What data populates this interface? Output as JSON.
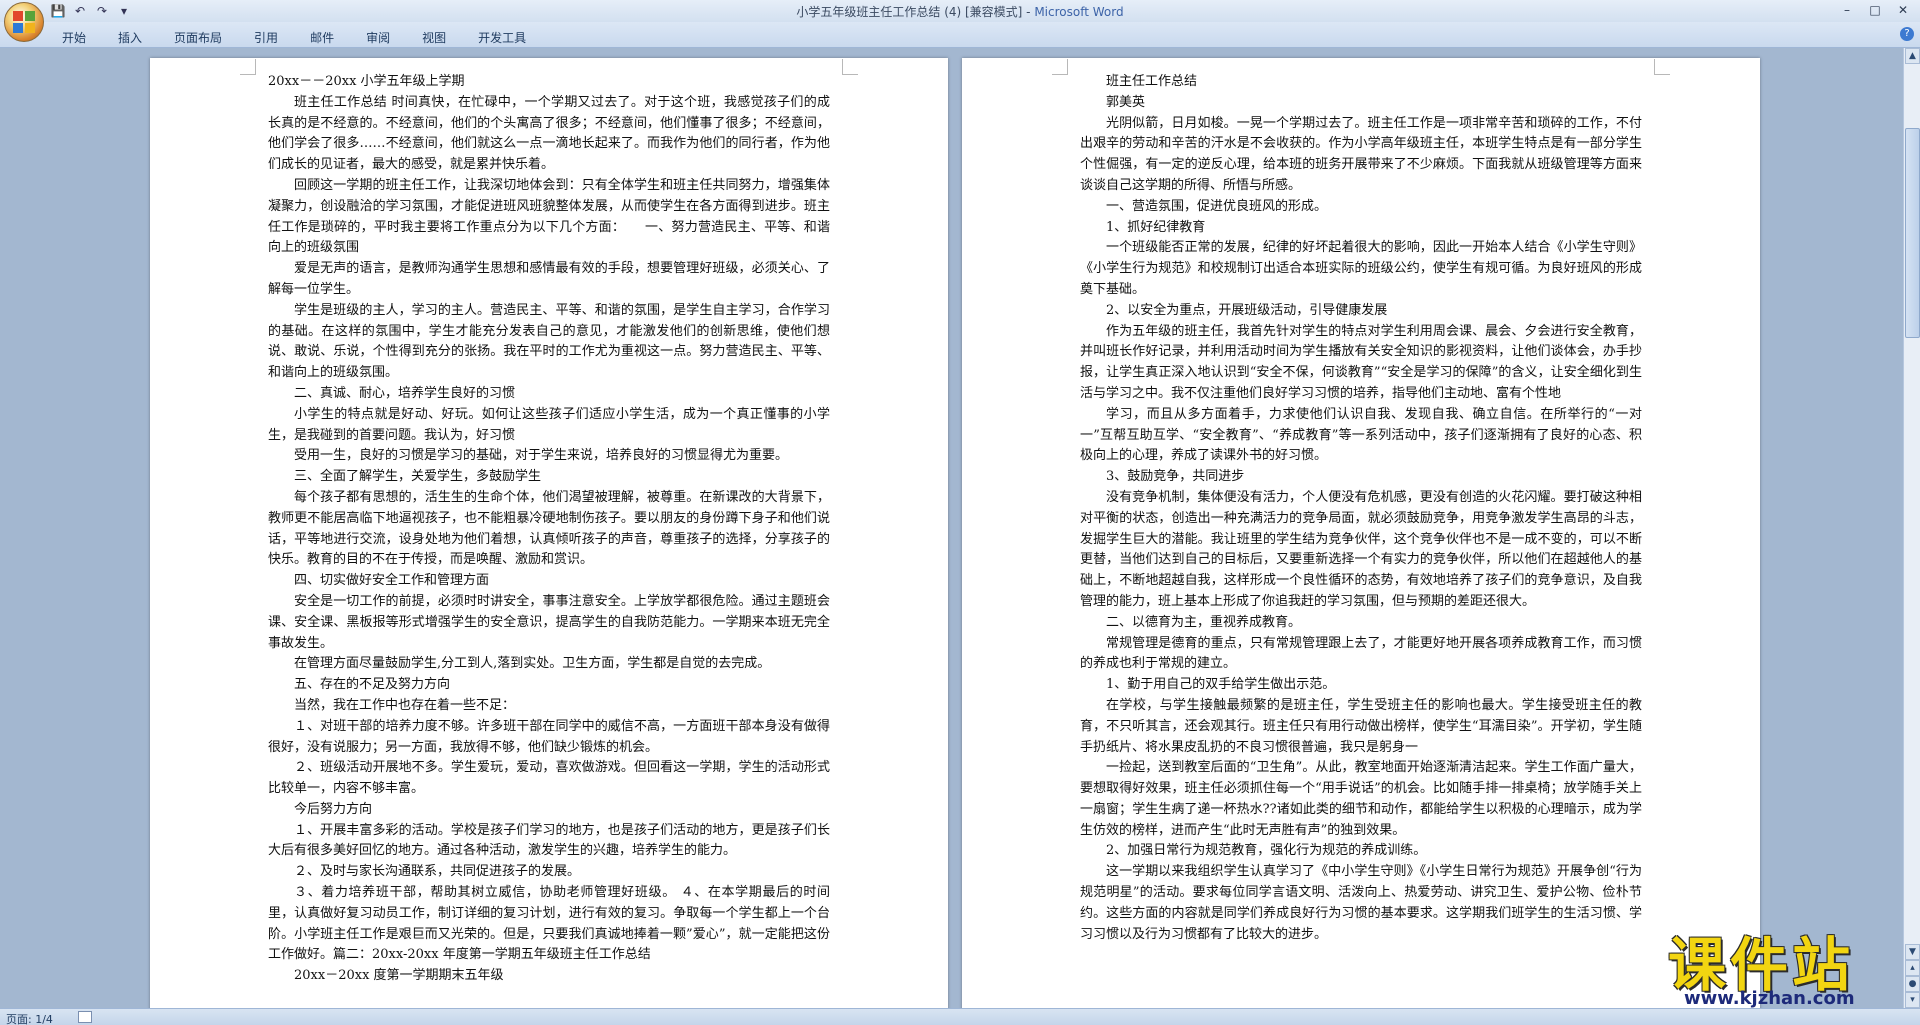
{
  "window": {
    "title": "小学五年级班主任工作总结 (4) [兼容模式] - ",
    "app_name": "Microsoft Word"
  },
  "quick_access": [
    "save-icon",
    "undo-icon",
    "redo-icon",
    "customize-icon"
  ],
  "ribbon": {
    "tabs": [
      "开始",
      "插入",
      "页面布局",
      "引用",
      "邮件",
      "审阅",
      "视图",
      "开发工具"
    ],
    "help_label": "?"
  },
  "window_controls": [
    "–",
    "□",
    "✕"
  ],
  "left_page": {
    "paragraphs": [
      {
        "t": "20xx－－20xx 小学五年级上学期",
        "i": 0
      },
      {
        "t": "班主任工作总结 时间真快，在忙碌中，一个学期又过去了。对于这个班，我感觉孩子们的成长真的是不经意的。不经意间，他们的个头寓高了很多；不经意间，他们懂事了很多；不经意间，他们学会了很多……不经意间，他们就这么一点一滴地长起来了。而我作为他们的同行者，作为他们成长的见证者，最大的感受，就是累并快乐着。",
        "i": 1
      },
      {
        "t": "回顾这一学期的班主任工作，让我深切地体会到：只有全体学生和班主任共同努力，增强集体凝聚力，创设融洽的学习氛围，才能促进班风班貌整体发展，从而使学生在各方面得到进步。班主任工作是琐碎的，平时我主要将工作重点分为以下几个方面：　　一、努力营造民主、平等、和谐向上的班级氛围",
        "i": 1
      },
      {
        "t": "爱是无声的语言，是教师沟通学生思想和感情最有效的手段，想要管理好班级，必须关心、了解每一位学生。",
        "i": 1
      },
      {
        "t": "学生是班级的主人，学习的主人。营造民主、平等、和谐的氛围，是学生自主学习，合作学习的基础。在这样的氛围中，学生才能充分发表自己的意见，才能激发他们的创新思维，使他们想说、敢说、乐说，个性得到充分的张扬。我在平时的工作尤为重视这一点。努力营造民主、平等、和谐向上的班级氛围。",
        "i": 1
      },
      {
        "t": "二、真诚、耐心，培养学生良好的习惯",
        "i": 1
      },
      {
        "t": "小学生的特点就是好动、好玩。如何让这些孩子们适应小学生活，成为一个真正懂事的小学生，是我碰到的首要问题。我认为，好习惯",
        "i": 1
      },
      {
        "t": "受用一生，良好的习惯是学习的基础，对于学生来说，培养良好的习惯显得尤为重要。",
        "i": 1
      },
      {
        "t": "三、全面了解学生，关爱学生，多鼓励学生",
        "i": 1
      },
      {
        "t": "每个孩子都有思想的，活生生的生命个体，他们渴望被理解，被尊重。在新课改的大背景下，教师更不能居高临下地逼视孩子，也不能粗暴冷硬地制伤孩子。要以朋友的身份蹲下身子和他们说话，平等地进行交流，设身处地为他们着想，认真倾听孩子的声音，尊重孩子的选择，分享孩子的快乐。教育的目的不在于传授，而是唤醒、激励和赏识。",
        "i": 1
      },
      {
        "t": "四、切实做好安全工作和管理方面",
        "i": 1
      },
      {
        "t": "安全是一切工作的前提，必须时时讲安全，事事注意安全。上学放学都很危险。通过主题班会课、安全课、黑板报等形式增强学生的安全意识，提高学生的自我防范能力。一学期来本班无完全事故发生。",
        "i": 1
      },
      {
        "t": "在管理方面尽量鼓励学生,分工到人,落到实处。卫生方面，学生都是自觉的去完成。",
        "i": 1
      },
      {
        "t": "五、存在的不足及努力方向",
        "i": 1
      },
      {
        "t": "当然，我在工作中也存在着一些不足：",
        "i": 1
      },
      {
        "t": "１、对班干部的培养力度不够。许多班干部在同学中的威信不高，一方面班干部本身没有做得很好，没有说服力；另一方面，我放得不够，他们缺少锻炼的机会。",
        "i": 1
      },
      {
        "t": "２、班级活动开展地不多。学生爱玩，爱动，喜欢做游戏。但回看这一学期，学生的活动形式比较单一，内容不够丰富。",
        "i": 1
      },
      {
        "t": "今后努力方向",
        "i": 1
      },
      {
        "t": "１、开展丰富多彩的活动。学校是孩子们学习的地方，也是孩子们活动的地方，更是孩子们长大后有很多美好回忆的地方。通过各种活动，激发学生的兴趣，培养学生的能力。",
        "i": 1
      },
      {
        "t": "２、及时与家长沟通联系，共同促进孩子的发展。",
        "i": 1
      },
      {
        "t": "３、着力培养班干部，帮助其树立威信，协助老师管理好班级。 ４、在本学期最后的时间里，认真做好复习动员工作，制订详细的复习计划，进行有效的复习。争取每一个学生都上一个台阶。小学班主任工作是艰巨而又光荣的。但是，只要我们真诚地捧着一颗”爱心”，就一定能把这份工作做好。篇二：20xx-20xx 年度第一学期五年级班主任工作总结",
        "i": 1
      },
      {
        "t": "20xx－20xx 度第一学期期末五年级",
        "i": 1
      }
    ]
  },
  "right_page": {
    "paragraphs": [
      {
        "t": "班主任工作总结",
        "i": 1
      },
      {
        "t": "郭美英",
        "i": 1
      },
      {
        "t": "光阴似箭，日月如梭。一晃一个学期过去了。班主任工作是一项非常辛苦和琐碎的工作，不付出艰辛的劳动和辛苦的汗水是不会收获的。作为小学高年级班主任，本班学生特点是有一部分学生个性倔强，有一定的逆反心理，给本班的班务开展带来了不少麻烦。下面我就从班级管理等方面来谈谈自己这学期的所得、所悟与所感。",
        "i": 1
      },
      {
        "t": "一、营造氛围，促进优良班风的形成。",
        "i": 1
      },
      {
        "t": "1、抓好纪律教育",
        "i": 1
      },
      {
        "t": "一个班级能否正常的发展，纪律的好坏起着很大的影响，因此一开始本人结合《小学生守则》《小学生行为规范》和校规制订出适合本班实际的班级公约，使学生有规可循。为良好班风的形成奠下基础。",
        "i": 1
      },
      {
        "t": "2、以安全为重点，开展班级活动，引导健康发展",
        "i": 1
      },
      {
        "t": "作为五年级的班主任，我首先针对学生的特点对学生利用周会课、晨会、夕会进行安全教育，并叫班长作好记录，并利用活动时间为学生播放有关安全知识的影视资料，让他们谈体会，办手抄报，让学生真正深入地认识到“安全不保，何谈教育”“安全是学习的保障”的含义，让安全细化到生活与学习之中。我不仅注重他们良好学习习惯的培养，指导他们主动地、富有个性地",
        "i": 1
      },
      {
        "t": "学习，而且从多方面着手，力求使他们认识自我、发现自我、确立自信。在所举行的“一对一”互帮互助互学、“安全教育”、“养成教育”等一系列活动中，孩子们逐渐拥有了良好的心态、积极向上的心理，养成了读课外书的好习惯。",
        "i": 1
      },
      {
        "t": "3、鼓励竞争，共同进步",
        "i": 1
      },
      {
        "t": "没有竞争机制，集体便没有活力，个人便没有危机感，更没有创造的火花闪耀。要打破这种相对平衡的状态，创造出一种充满活力的竞争局面，就必须鼓励竞争，用竞争激发学生高昂的斗志，发掘学生巨大的潜能。我让班里的学生结为竞争伙伴，这个竞争伙伴也不是一成不变的，可以不断更替，当他们达到自己的目标后，又要重新选择一个有实力的竞争伙伴，所以他们在超越他人的基础上，不断地超越自我，这样形成一个良性循环的态势，有效地培养了孩子们的竞争意识，及自我管理的能力，班上基本上形成了你追我赶的学习氛围，但与预期的差距还很大。",
        "i": 1
      },
      {
        "t": "二、以德育为主，重视养成教育。",
        "i": 1
      },
      {
        "t": "常规管理是德育的重点，只有常规管理跟上去了，才能更好地开展各项养成教育工作，而习惯的养成也利于常规的建立。",
        "i": 1
      },
      {
        "t": "1、勤于用自己的双手给学生做出示范。",
        "i": 1
      },
      {
        "t": "在学校，与学生接触最频繁的是班主任，学生受班主任的影响也最大。学生接受班主任的教育，不只听其言，还会观其行。班主任只有用行动做出榜样，使学生“耳濡目染”。开学初，学生随手扔纸片、将水果皮乱扔的不良习惯很普遍，我只是躬身一",
        "i": 1
      },
      {
        "t": "一捡起，送到教室后面的“卫生角”。从此，教室地面开始逐渐清洁起来。学生工作面广量大，要想取得好效果，班主任必须抓住每一个“用手说话”的机会。比如随手排一排桌椅；放学随手关上一扇窗；学生生病了递一杯热水??诸如此类的细节和动作，都能给学生以积极的心理暗示，成为学生仿效的榜样，进而产生“此时无声胜有声”的独到效果。",
        "i": 1
      },
      {
        "t": "2、加强日常行为规范教育，强化行为规范的养成训练。",
        "i": 1
      },
      {
        "t": "这一学期以来我组织学生认真学习了《中小学生守则》《小学生日常行为规范》开展争创“行为规范明星”的活动。要求每位同学言语文明、活泼向上、热爱劳动、讲究卫生、爱护公物、俭朴节约。这些方面的内容就是同学们养成良好行为习惯的基本要求。这学期我们班学生的生活习惯、学习习惯以及行为习惯都有了比较大的进步。",
        "i": 1
      }
    ]
  },
  "status_bar": {
    "page_info": "页面: 1/4"
  },
  "watermark": {
    "big": "课件站",
    "url": "www.kjzhan.com"
  }
}
